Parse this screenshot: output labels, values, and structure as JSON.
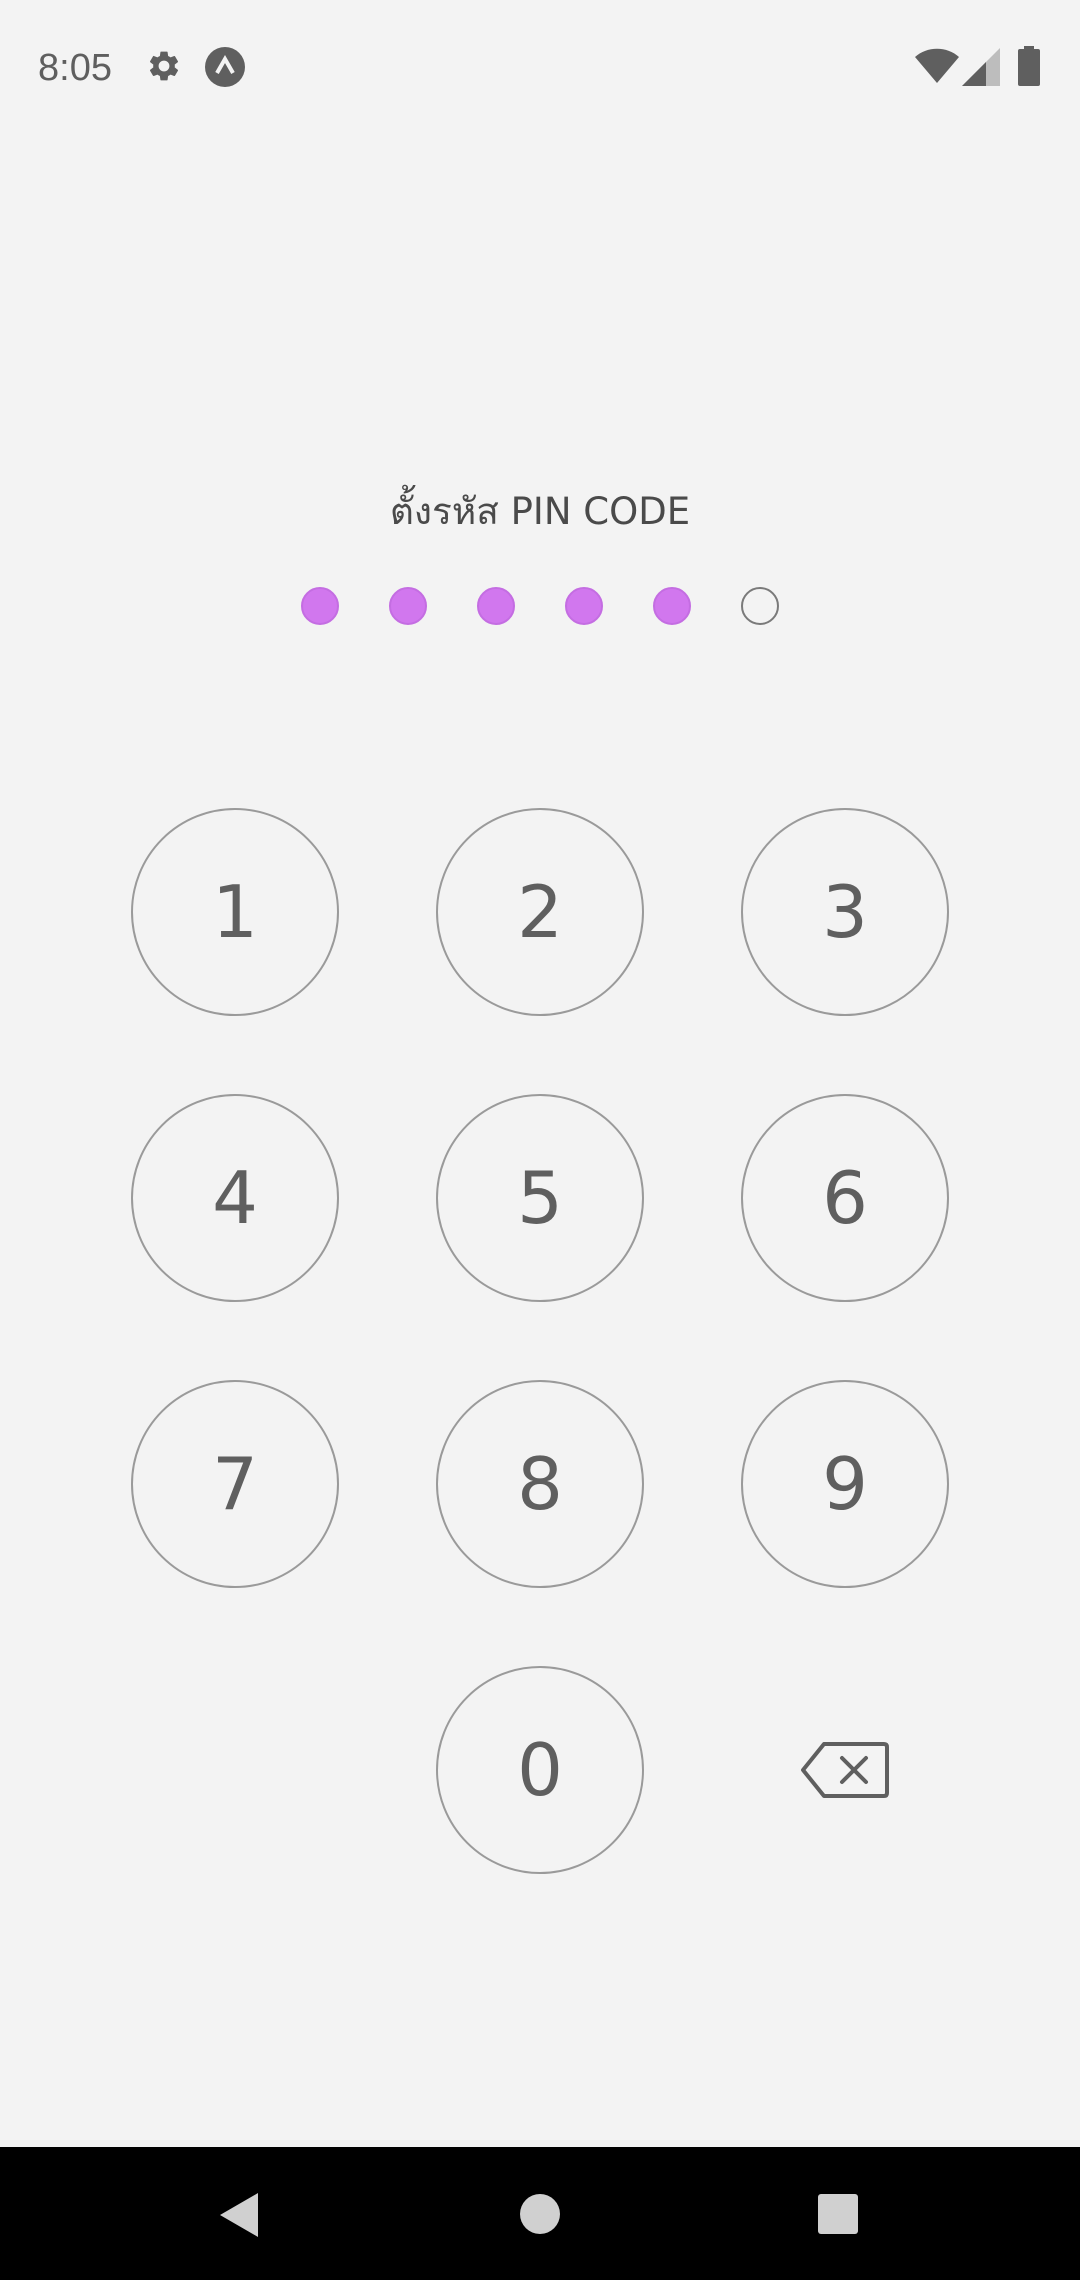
{
  "status_bar": {
    "time": "8:05",
    "icons": [
      "gear-icon",
      "app-notification-icon",
      "wifi-icon",
      "cellular-signal-icon",
      "battery-icon"
    ]
  },
  "title": "ตั้งรหัส PIN CODE",
  "pin": {
    "length": 6,
    "filled": 5,
    "filled_color": "#d177ee"
  },
  "keypad": {
    "keys": [
      "1",
      "2",
      "3",
      "4",
      "5",
      "6",
      "7",
      "8",
      "9",
      "0"
    ],
    "backspace_icon": "backspace-icon"
  },
  "nav_bar": {
    "buttons": [
      "back-icon",
      "home-icon",
      "recents-icon"
    ]
  }
}
